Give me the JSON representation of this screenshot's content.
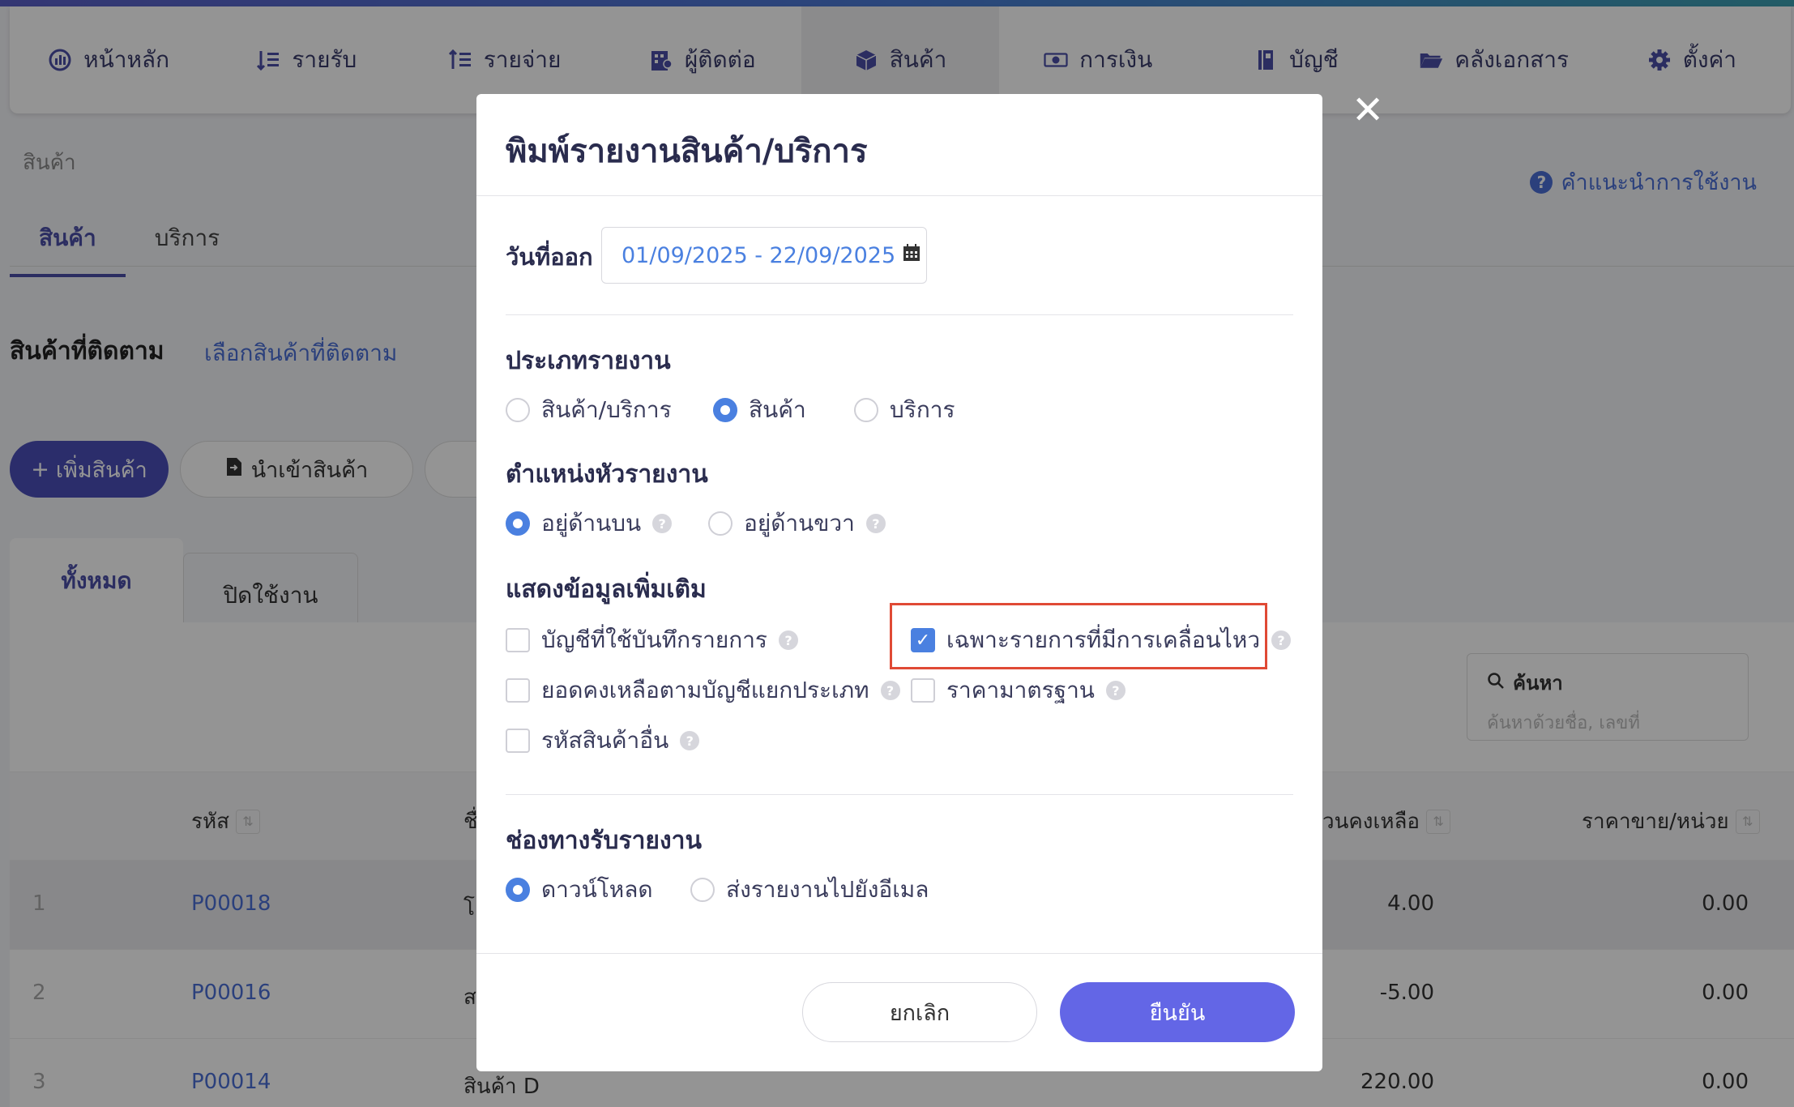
{
  "nav": {
    "items": [
      {
        "label": "หน้าหลัก",
        "icon": "dashboard-icon"
      },
      {
        "label": "รายรับ",
        "icon": "income-icon"
      },
      {
        "label": "รายจ่าย",
        "icon": "expense-icon"
      },
      {
        "label": "ผู้ติดต่อ",
        "icon": "contacts-icon"
      },
      {
        "label": "สินค้า",
        "icon": "box-icon"
      },
      {
        "label": "การเงิน",
        "icon": "money-icon"
      },
      {
        "label": "บัญชี",
        "icon": "ledger-icon"
      },
      {
        "label": "คลังเอกสาร",
        "icon": "folder-icon"
      },
      {
        "label": "ตั้งค่า",
        "icon": "gear-icon"
      }
    ],
    "active_index": 4
  },
  "page": {
    "breadcrumb": "สินค้า",
    "help_link": "คำแนะนำการใช้งาน",
    "tabs": [
      "สินค้า",
      "บริการ"
    ],
    "tracked_title": "สินค้าที่ติดตาม",
    "tracked_link": "เลือกสินค้าที่ติดตาม",
    "add_button": "เพิ่มสินค้า",
    "import_button": "นำเข้าสินค้า",
    "subtabs": [
      "ทั้งหมด",
      "ปิดใช้งาน"
    ],
    "search_label": "ค้นหา",
    "search_placeholder": "ค้นหาด้วยชื่อ, เลขที่",
    "columns": {
      "code": "รหัส",
      "name": "ชื่",
      "qty": "วนคงเหลือ",
      "price": "ราคาขาย/หน่วย"
    },
    "rows": [
      {
        "num": "1",
        "code": "P00018",
        "name": "โ",
        "qty": "4.00",
        "price": "0.00"
      },
      {
        "num": "2",
        "code": "P00016",
        "name": "ส",
        "qty": "-5.00",
        "price": "0.00"
      },
      {
        "num": "3",
        "code": "P00014",
        "name": "สินค้า D",
        "qty": "220.00",
        "price": "0.00"
      }
    ]
  },
  "modal": {
    "title": "พิมพ์รายงานสินค้า/บริการ",
    "date_label": "วันที่ออก",
    "date_range": "01/09/2025 - 22/09/2025",
    "report_type": {
      "title": "ประเภทรายงาน",
      "options": [
        "สินค้า/บริการ",
        "สินค้า",
        "บริการ"
      ],
      "selected": "สินค้า"
    },
    "header_position": {
      "title": "ตำแหน่งหัวรายงาน",
      "options": [
        "อยู่ด้านบน",
        "อยู่ด้านขวา"
      ],
      "selected": "อยู่ด้านบน"
    },
    "extra_info": {
      "title": "แสดงข้อมูลเพิ่มเติม",
      "options": [
        {
          "label": "บัญชีที่ใช้บันทึกรายการ",
          "checked": false
        },
        {
          "label": "เฉพาะรายการที่มีการเคลื่อนไหว",
          "checked": true
        },
        {
          "label": "ยอดคงเหลือตามบัญชีแยกประเภท",
          "checked": false
        },
        {
          "label": "ราคามาตรฐาน",
          "checked": false
        },
        {
          "label": "รหัสสินค้าอื่น",
          "checked": false
        }
      ]
    },
    "channel": {
      "title": "ช่องทางรับรายงาน",
      "options": [
        "ดาวน์โหลด",
        "ส่งรายงานไปยังอีเมล"
      ],
      "selected": "ดาวน์โหลด"
    },
    "cancel_label": "ยกเลิก",
    "confirm_label": "ยืนยัน",
    "close_symbol": "✕"
  },
  "colors": {
    "accent": "#4a80e0",
    "primary": "#6366e6",
    "highlight": "#e04a35",
    "nav_text": "#3a3c6c"
  }
}
